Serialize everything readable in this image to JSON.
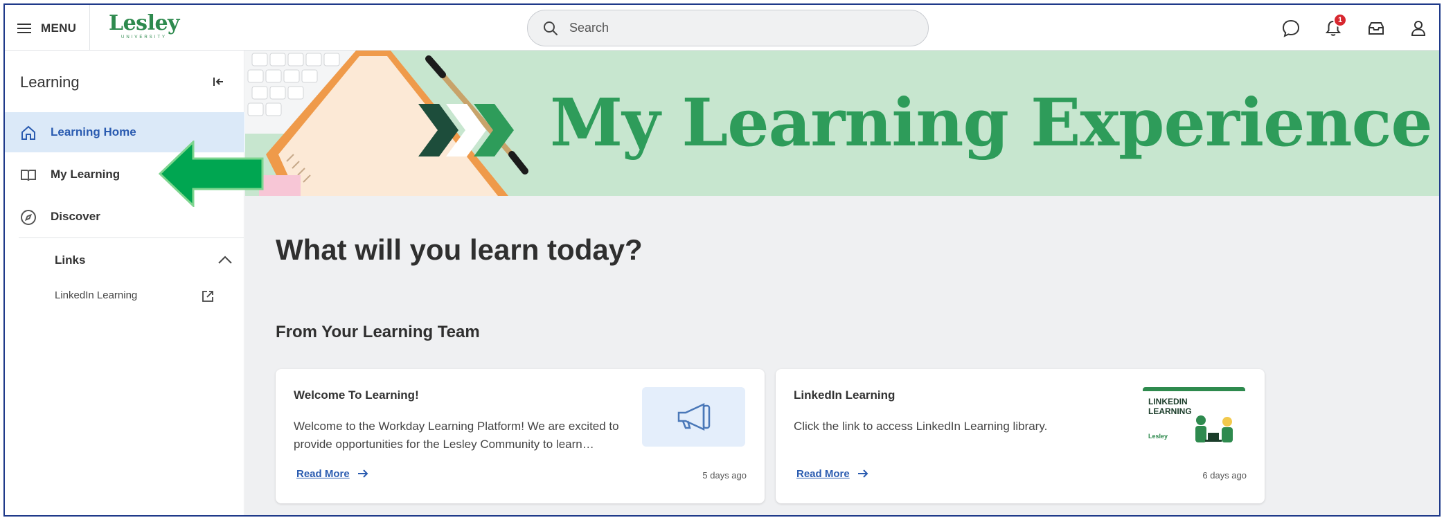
{
  "header": {
    "menu_label": "MENU",
    "logo_text": "Lesley",
    "logo_subtext": "UNIVERSITY",
    "search_placeholder": "Search",
    "notification_count": "1",
    "icons": [
      "menu-icon",
      "search-icon",
      "chat-icon",
      "bell-icon",
      "inbox-icon",
      "user-icon"
    ]
  },
  "sidebar": {
    "title": "Learning",
    "items": [
      {
        "label": "Learning Home",
        "icon": "home-icon",
        "active": true
      },
      {
        "label": "My Learning",
        "icon": "book-icon",
        "active": false
      },
      {
        "label": "Discover",
        "icon": "compass-icon",
        "active": false
      }
    ],
    "links_heading": "Links",
    "links": [
      {
        "label": "LinkedIn Learning",
        "icon": "external-link-icon"
      }
    ]
  },
  "banner": {
    "title": "My Learning Experience"
  },
  "main": {
    "heading": "What will you learn today?",
    "section_title": "From Your Learning Team",
    "cards": [
      {
        "title": "Welcome To Learning!",
        "body": "Welcome to the Workday Learning Platform! We are excited to provide opportunities for the Lesley Community to learn…",
        "read_more": "Read More",
        "time": "5 days ago",
        "thumbnail": "megaphone-icon"
      },
      {
        "title": "LinkedIn Learning",
        "body": "Click the link to access LinkedIn Learning library.",
        "read_more": "Read More",
        "time": "6 days ago",
        "thumbnail_text": "LINKEDIN LEARNING",
        "thumbnail_logo": "Lesley"
      }
    ]
  },
  "colors": {
    "brand_green": "#2e8a4e",
    "banner_bg": "#c7e6cf",
    "active_nav_bg": "#dbe9f8",
    "link_blue": "#2a5bb0",
    "badge_red": "#d7272f",
    "annotation_arrow": "#00a651"
  }
}
